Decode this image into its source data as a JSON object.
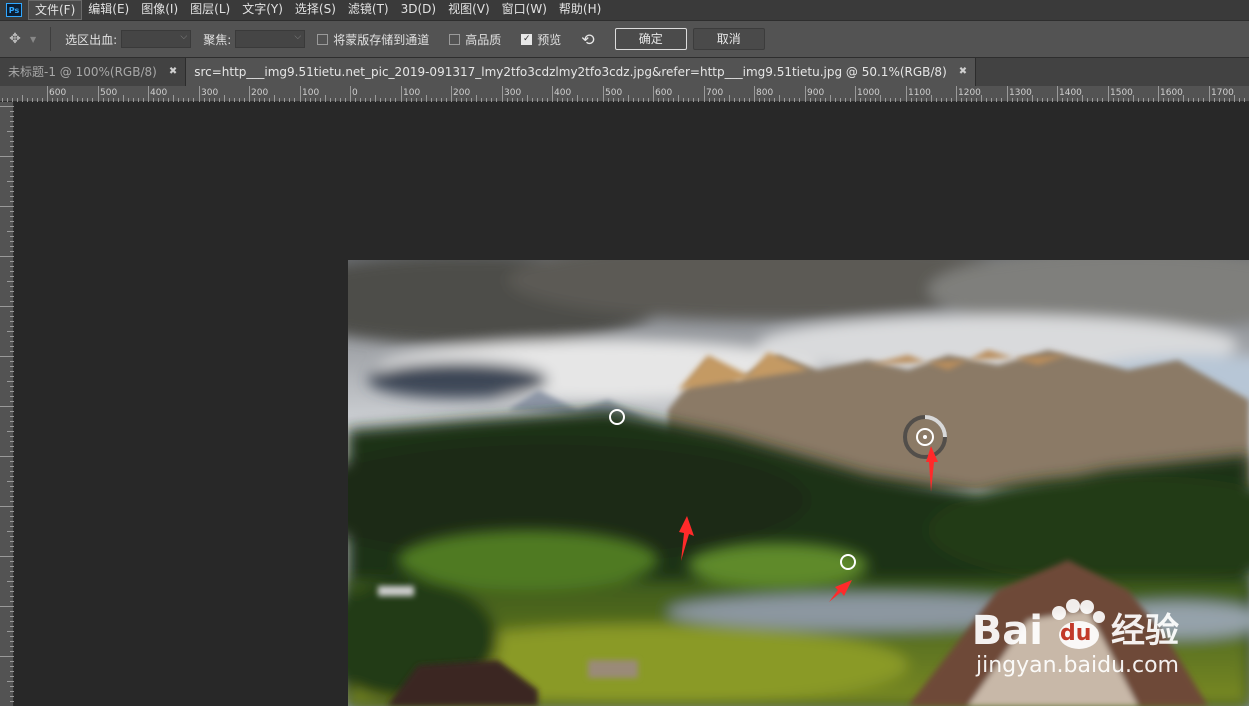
{
  "menubar": {
    "logo": "Ps",
    "items": [
      "文件(F)",
      "编辑(E)",
      "图像(I)",
      "图层(L)",
      "文字(Y)",
      "选择(S)",
      "滤镜(T)",
      "3D(D)",
      "视图(V)",
      "窗口(W)",
      "帮助(H)"
    ]
  },
  "options": {
    "output_label": "选区出血:",
    "focus_label": "聚焦:",
    "save_mask_label": "将蒙版存储到通道",
    "high_quality_label": "高品质",
    "preview_label": "预览",
    "ok_label": "确定",
    "cancel_label": "取消",
    "preview_checked": true
  },
  "tabs": [
    {
      "label": "未标题-1 @ 100%(RGB/8)",
      "active": false
    },
    {
      "label": "src=http___img9.51tietu.net_pic_2019-091317_lmy2tfo3cdzlmy2tfo3cdz.jpg&refer=http___img9.51tietu.jpg @ 50.1%(RGB/8)",
      "active": true
    }
  ],
  "ruler": {
    "labels": [
      "600",
      "500",
      "400",
      "300",
      "200",
      "100",
      "0",
      "100",
      "200",
      "300",
      "400",
      "500",
      "600",
      "700",
      "800",
      "900",
      "1000",
      "1100",
      "1200",
      "1300",
      "1400",
      "1500",
      "1600",
      "1700"
    ]
  },
  "watermark": {
    "brand": "Bai",
    "brand2": "du",
    "suffix": "经验",
    "url": "jingyan.baidu.com"
  },
  "colors": {
    "annotation_arrow": "#ff2a2a",
    "accent": "#31a8ff"
  }
}
